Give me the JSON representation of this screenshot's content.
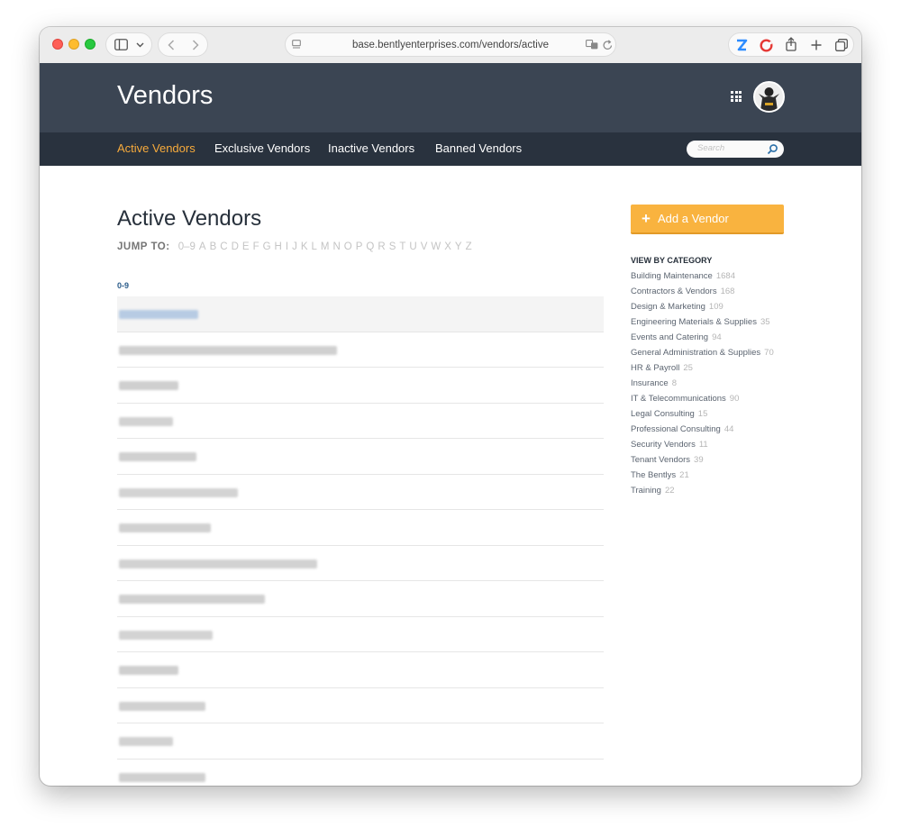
{
  "browser": {
    "url": "base.bentlyenterprises.com/vendors/active"
  },
  "header": {
    "title": "Vendors"
  },
  "nav": {
    "items": [
      {
        "label": "Active Vendors",
        "active": true
      },
      {
        "label": "Exclusive Vendors",
        "active": false
      },
      {
        "label": "Inactive Vendors",
        "active": false
      },
      {
        "label": "Banned Vendors",
        "active": false
      }
    ],
    "search_placeholder": "Search"
  },
  "main": {
    "heading": "Active Vendors",
    "jump_label": "JUMP TO:",
    "jump_letters": [
      "0–9",
      "A",
      "B",
      "C",
      "D",
      "E",
      "F",
      "G",
      "H",
      "I",
      "J",
      "K",
      "L",
      "M",
      "N",
      "O",
      "P",
      "Q",
      "R",
      "S",
      "T",
      "U",
      "V",
      "W",
      "X",
      "Y",
      "Z"
    ],
    "section_label": "0-9",
    "vendor_rows": [
      {
        "highlighted": true,
        "blur_color": "#b7cbe3"
      },
      {
        "highlighted": false,
        "blur_color": "#d0d0d0"
      },
      {
        "highlighted": false,
        "blur_color": "#cfcfcf"
      },
      {
        "highlighted": false,
        "blur_color": "#d2d2d2"
      },
      {
        "highlighted": false,
        "blur_color": "#d0d0d0"
      },
      {
        "highlighted": false,
        "blur_color": "#d3d3d3"
      },
      {
        "highlighted": false,
        "blur_color": "#d1d1d1"
      },
      {
        "highlighted": false,
        "blur_color": "#d2d2d2"
      },
      {
        "highlighted": false,
        "blur_color": "#d0d0d0"
      },
      {
        "highlighted": false,
        "blur_color": "#d3d3d3"
      },
      {
        "highlighted": false,
        "blur_color": "#cfcfcf"
      },
      {
        "highlighted": false,
        "blur_color": "#d1d1d1"
      },
      {
        "highlighted": false,
        "blur_color": "#d2d2d2"
      },
      {
        "highlighted": false,
        "blur_color": "#d0d0d0"
      }
    ]
  },
  "sidebar": {
    "add_button_label": "Add a Vendor",
    "category_heading": "VIEW BY CATEGORY",
    "categories": [
      {
        "name": "Building Maintenance",
        "count": "1684"
      },
      {
        "name": "Contractors & Vendors",
        "count": "168"
      },
      {
        "name": "Design & Marketing",
        "count": "109"
      },
      {
        "name": "Engineering Materials & Supplies",
        "count": "35"
      },
      {
        "name": "Events and Catering",
        "count": "94"
      },
      {
        "name": "General Administration & Supplies",
        "count": "70"
      },
      {
        "name": "HR & Payroll",
        "count": "25"
      },
      {
        "name": "Insurance",
        "count": "8"
      },
      {
        "name": "IT & Telecommunications",
        "count": "90"
      },
      {
        "name": "Legal Consulting",
        "count": "15"
      },
      {
        "name": "Professional Consulting",
        "count": "44"
      },
      {
        "name": "Security Vendors",
        "count": "11"
      },
      {
        "name": "Tenant Vendors",
        "count": "39"
      },
      {
        "name": "The Bentlys",
        "count": "21"
      },
      {
        "name": "Training",
        "count": "22"
      }
    ]
  },
  "colors": {
    "header_bg": "#3b4553",
    "nav_bg": "#29323e",
    "accent_orange": "#f9b33f",
    "active_nav": "#f7ab3c"
  }
}
